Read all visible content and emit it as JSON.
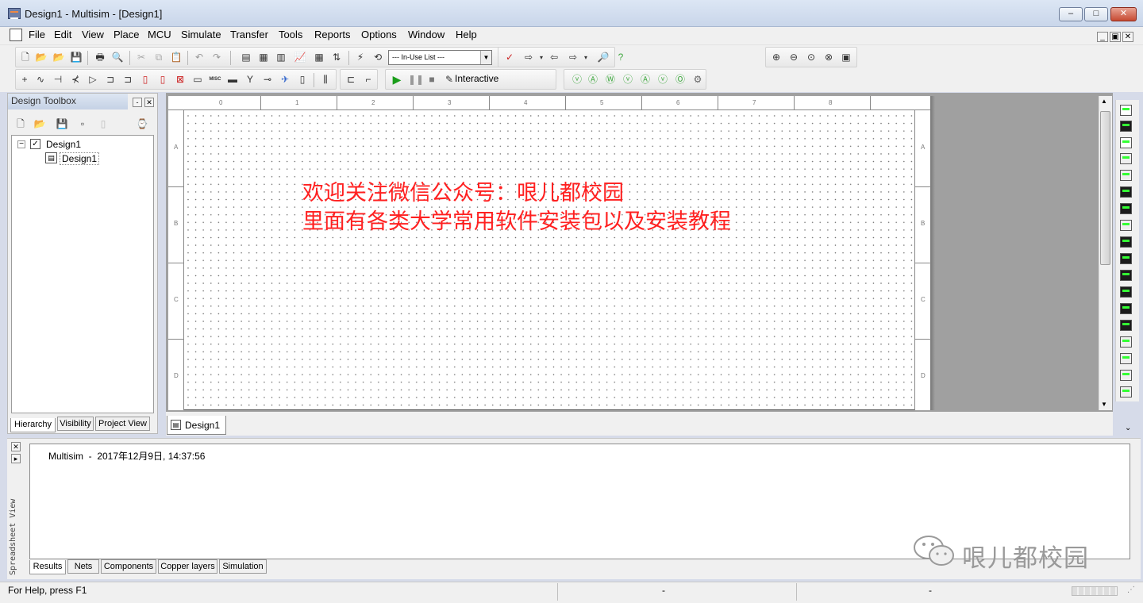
{
  "window": {
    "title": "Design1 - Multisim - [Design1]",
    "controls": {
      "minimize": "–",
      "maximize": "□",
      "close": "✕"
    }
  },
  "menu": {
    "items": [
      "File",
      "Edit",
      "View",
      "Place",
      "MCU",
      "Simulate",
      "Transfer",
      "Tools",
      "Reports",
      "Options",
      "Window",
      "Help"
    ],
    "mdi_controls": {
      "minimize": "_",
      "restore": "▣",
      "close": "✕"
    }
  },
  "toolbar": {
    "in_use_list": "--- In-Use List ---",
    "interactive": "Interactive",
    "misc_label": "MISC"
  },
  "toolbox": {
    "title": "Design Toolbox",
    "tree": {
      "root": "Design1",
      "child": "Design1"
    },
    "tabs": [
      "Hierarchy",
      "Visibility",
      "Project View"
    ]
  },
  "sheet": {
    "col_labels": [
      "0",
      "1",
      "2",
      "3",
      "4",
      "5",
      "6",
      "7",
      "8"
    ],
    "row_labels": [
      "A",
      "B",
      "C",
      "D"
    ],
    "banner_line1": "欢迎关注微信公众号：哏儿都校园",
    "banner_line2": "里面有各类大学常用软件安装包以及安装教程"
  },
  "design_tab": {
    "label": "Design1"
  },
  "spreadsheet": {
    "side_label": "Spreadsheet View",
    "result_line": "Multisim  -  2017年12月9日, 14:37:56",
    "tabs": [
      "Results",
      "Nets",
      "Components",
      "Copper layers",
      "Simulation"
    ]
  },
  "status": {
    "help": "For Help, press F1",
    "field2": "-",
    "field3": "-"
  },
  "watermark": {
    "text": "哏儿都校园"
  },
  "colors": {
    "banner": "#ff2020",
    "titlebar": "#c9d6ea",
    "watermark": "#9a9a9a"
  }
}
